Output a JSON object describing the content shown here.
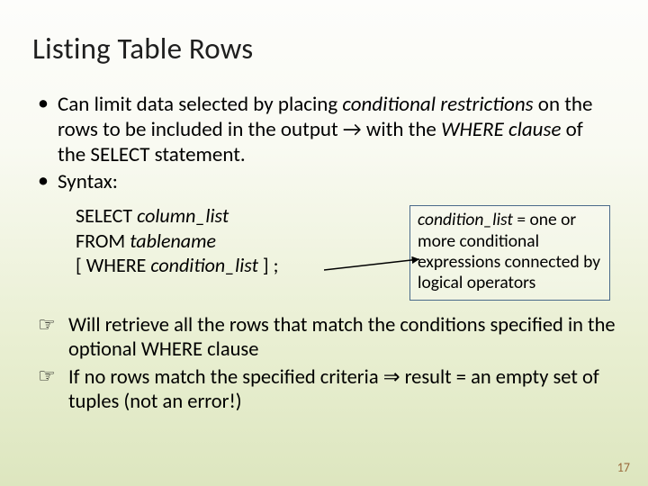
{
  "title": "Listing Table Rows",
  "bullets": {
    "b1_pre": "Can limit data selected by placing ",
    "b1_em1": "conditional restrictions",
    "b1_mid": " on the rows to be included in the output → with the ",
    "b1_em2": "WHERE clause",
    "b1_post": " of the SELECT statement.",
    "b2": "Syntax:"
  },
  "syntax": {
    "line1_kw": "SELECT ",
    "line1_em": "column_list",
    "line2_kw": "FROM ",
    "line2_em": "tablename",
    "line3_pre": "[ WHERE ",
    "line3_em": "condition_list",
    "line3_post": " ] ;"
  },
  "defbox": {
    "em": "condition_list",
    "rest": " = one or more conditional expressions connected by logical operators"
  },
  "fingers": {
    "f1": "Will retrieve all the rows that match the conditions specified in the optional WHERE clause",
    "f2_pre": "If no rows match the specified criteria ",
    "f2_arrow": "⇒",
    "f2_post": " result = an empty set of tuples (not an error!)"
  },
  "pagenum": "17",
  "icons": {
    "hand": "☞"
  }
}
